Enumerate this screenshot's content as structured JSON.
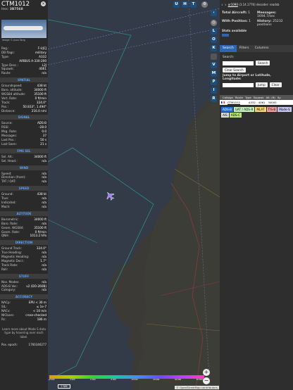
{
  "info": {
    "callsign": "CTM1012",
    "hex_label": "Hex:",
    "hex": "3B7568",
    "photo_credit": "Image © Jussi Tang",
    "fields": [
      {
        "label": "Reg.:",
        "value": "F-UJCJ"
      },
      {
        "label": "DB flags:",
        "value": "military"
      },
      {
        "label": "Type:",
        "value": "A332"
      },
      {
        "label": "",
        "value": "AIRBUS A-330-200"
      },
      {
        "label": "Type Desc.:",
        "value": "L2J"
      },
      {
        "label": "Squawk:",
        "value": "4061"
      },
      {
        "label": "Route:",
        "value": "n/a"
      }
    ],
    "sections": [
      {
        "title": "SPATIAL",
        "rows": [
          {
            "label": "Groundspeed:",
            "value": "438 kt"
          },
          {
            "label": "Baro. altitude:",
            "value": "34000 ft"
          },
          {
            "label": "WGS84 altitude:",
            "value": "35100 ft"
          },
          {
            "label": "Vert. Rate:",
            "value": "0 ft/min"
          },
          {
            "label": "Track:",
            "value": "324.0°"
          },
          {
            "label": "Pos.:",
            "value": "50.833°, 1.494°"
          },
          {
            "label": "Distance:",
            "value": "216.0 nmi"
          }
        ]
      },
      {
        "title": "SIGNAL",
        "rows": [
          {
            "label": "Source:",
            "value": "ADS-B"
          },
          {
            "label": "RSSI:",
            "value": "-28.0"
          },
          {
            "label": "Msg. Rate:",
            "value": "0.0"
          },
          {
            "label": "Messages:",
            "value": "37"
          },
          {
            "label": "Last Pos.:",
            "value": "50 s"
          },
          {
            "label": "Last Seen:",
            "value": "21 s"
          }
        ]
      },
      {
        "title": "FMS SEL",
        "rows": [
          {
            "label": "Sel. Alt.:",
            "value": "34000 ft"
          },
          {
            "label": "Sel. Head.:",
            "value": "n/a"
          }
        ]
      },
      {
        "title": "WIND",
        "rows": [
          {
            "label": "Speed:",
            "value": "n/a"
          },
          {
            "label": "Direction (from):",
            "value": "n/a"
          },
          {
            "label": "TAT / OAT:",
            "value": "n/a"
          }
        ]
      },
      {
        "title": "SPEED",
        "rows": [
          {
            "label": "Ground:",
            "value": "438 kt"
          },
          {
            "label": "True:",
            "value": "n/a"
          },
          {
            "label": "Indicated:",
            "value": "n/a"
          },
          {
            "label": "Mach:",
            "value": "n/a"
          }
        ]
      },
      {
        "title": "ALTITUDE",
        "rows": [
          {
            "label": "Barometric:",
            "value": "34000 ft"
          },
          {
            "label": "Baro. Rate:",
            "value": "n/a"
          },
          {
            "label": "Geom. WGS84:",
            "value": "35100 ft"
          },
          {
            "label": "Geom. Rate:",
            "value": "0 ft/min"
          },
          {
            "label": "QNH:",
            "value": "1013.2 hPa"
          }
        ]
      },
      {
        "title": "DIRECTION",
        "rows": [
          {
            "label": "Ground Track:",
            "value": "324.0°"
          },
          {
            "label": "True Heading:",
            "value": "n/a"
          },
          {
            "label": "Magnetic Heading:",
            "value": "n/a"
          },
          {
            "label": "Magnetic Decl.:",
            "value": "1.7°"
          },
          {
            "label": "Track Rate:",
            "value": "n/a"
          },
          {
            "label": "Roll:",
            "value": "n/a"
          }
        ]
      },
      {
        "title": "STUFF",
        "rows": [
          {
            "label": "Nav. Modes:",
            "value": "n/a"
          },
          {
            "label": "ADS-B Ver.:",
            "value": "v2 (DO-260B)"
          },
          {
            "label": "Category:",
            "value": "n/a"
          }
        ]
      },
      {
        "title": "ACCURACY",
        "rows": [
          {
            "label": "NACp:",
            "value": "EPU < 30 m"
          },
          {
            "label": "SIL:",
            "value": "≤ 1e-7"
          },
          {
            "label": "NACv:",
            "value": "< 10 m/s"
          },
          {
            "label": "NICbaro:",
            "value": "cross-checked"
          },
          {
            "label": "Rc:",
            "value": "186 m"
          }
        ]
      }
    ],
    "note": "Learn more about Mode S data type by hovering over each label.",
    "pos_epoch_label": "Pos. epoch:",
    "pos_epoch": "1760346277"
  },
  "map": {
    "buttons_top": [
      "U",
      "H",
      "T"
    ],
    "buttons_side": [
      "L",
      "O",
      "K",
      "M",
      "P",
      "I",
      "R"
    ],
    "scale": "2 NM",
    "alt_legend": [
      "2 000",
      "4 000",
      "6 000",
      "8 000",
      "10 000",
      "20 000",
      "30 000",
      "40 000+"
    ],
    "attribution": "© OpenStreetMap contributors"
  },
  "panel": {
    "version_link": "ar1090",
    "version_text": "(3.14.1776) decoder: readsb",
    "stats": [
      {
        "label": "Total Aircraft:",
        "value": "1"
      },
      {
        "label": "Messages:",
        "value": "1694.7/sec"
      },
      {
        "label": "With Position:",
        "value": "1"
      },
      {
        "label": "History:",
        "value": "25232 positions"
      }
    ],
    "stats_available": "Stats available",
    "tabs": [
      "Search",
      "Filters",
      "Columns"
    ],
    "search_label": "Search:",
    "search_button": "Search",
    "clear_search": "Clear Search",
    "jump_label": "Jump to Airport or Latitude, Longitude:",
    "jump_button": "Jump",
    "clear_button": "Clear",
    "table_headers": [
      "Callsign",
      "Route",
      "Type",
      "Squawk",
      "Alt. (ft)",
      "Sp"
    ],
    "table_row": {
      "callsign": "CTM1012",
      "type": "A332",
      "squawk": "4061",
      "alt": "34000"
    },
    "sources": [
      {
        "label": "ADS-B",
        "color": "#1d6fd8"
      },
      {
        "label": "UAT / ADS-R",
        "color": "#c7f0c0"
      },
      {
        "label": "MLAT",
        "color": "#f5d77a"
      },
      {
        "label": "TIS-B",
        "color": "#f2a0a0"
      },
      {
        "label": "Mode-S",
        "color": "#c5c5ee"
      },
      {
        "label": "AIS",
        "color": "#ddd"
      },
      {
        "label": "ADS-C",
        "color": "#b6e37a"
      }
    ]
  }
}
